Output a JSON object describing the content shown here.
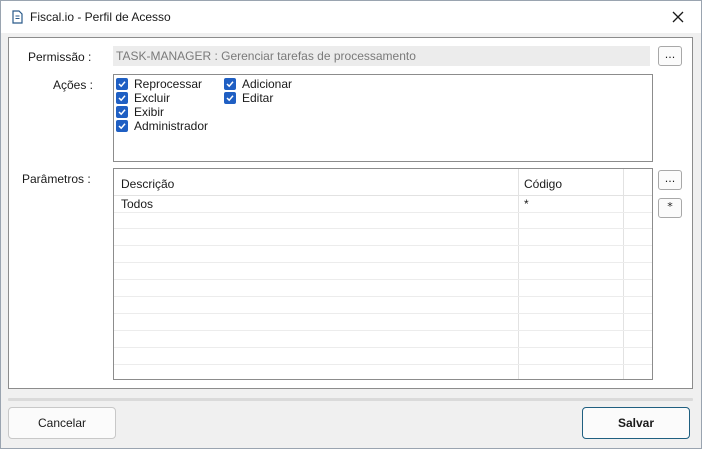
{
  "window": {
    "title": "Fiscal.io - Perfil de Acesso"
  },
  "form": {
    "permission_label": "Permissão :",
    "permission_value": "TASK-MANAGER : Gerenciar tarefas de processamento",
    "permission_button": "...",
    "actions_label": "Ações :",
    "actions": [
      {
        "label": "Reprocessar",
        "checked": true
      },
      {
        "label": "Excluir",
        "checked": true
      },
      {
        "label": "Exibir",
        "checked": true
      },
      {
        "label": "Administrador",
        "checked": true
      },
      {
        "label": "Adicionar",
        "checked": true
      },
      {
        "label": "Editar",
        "checked": true
      }
    ],
    "params_label": "Parâmetros :",
    "params_button_browse": "...",
    "params_button_star": "*"
  },
  "table": {
    "columns": [
      "Descrição",
      "Código"
    ],
    "rows": [
      {
        "descricao": "Todos",
        "codigo": "*"
      }
    ]
  },
  "footer": {
    "cancel_label": "Cancelar",
    "save_label": "Salvar"
  },
  "colors": {
    "checkbox": "#1f5fc3",
    "save_border": "#1f5f80"
  },
  "icons": {
    "app": "document-icon",
    "close": "close-icon"
  }
}
